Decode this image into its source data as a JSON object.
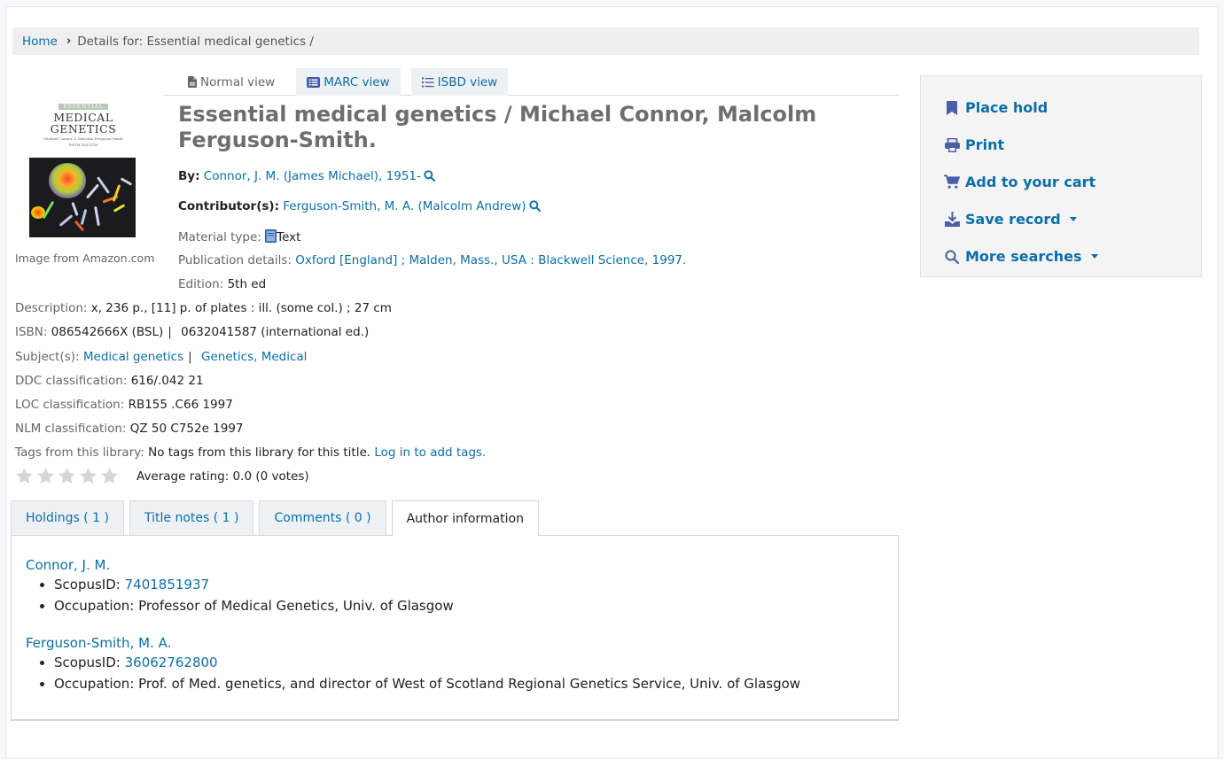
{
  "breadcrumb": {
    "home": "Home",
    "separator": "›",
    "current": "Details for: Essential medical genetics /"
  },
  "cover": {
    "credit": "Image from Amazon.com",
    "cover_text": {
      "series": "ESSENTIAL",
      "line1": "MEDICAL",
      "line2": "GENETICS",
      "authors": "Michael Connor & Malcolm Ferguson-Smith",
      "edition": "FIFTH EDITION"
    }
  },
  "view_tabs": [
    {
      "label": "Normal view",
      "icon": "file-icon",
      "active": true
    },
    {
      "label": "MARC view",
      "icon": "list-alt-icon",
      "active": false
    },
    {
      "label": "ISBD view",
      "icon": "list-icon",
      "active": false
    }
  ],
  "record": {
    "title": "Essential medical genetics / Michael Connor, Malcolm Ferguson-Smith.",
    "by_label": "By:",
    "by_value": "Connor, J. M. (James Michael), 1951-",
    "contributors_label": "Contributor(s):",
    "contributors_value": "Ferguson-Smith, M. A. (Malcolm Andrew)",
    "material_type_label": "Material type:",
    "material_type_value": "Text",
    "publication_label": "Publication details:",
    "publication_value": "Oxford [England] ; Malden, Mass., USA : Blackwell Science, 1997.",
    "edition_label": "Edition:",
    "edition_value": "5th ed",
    "description_label": "Description:",
    "description_value": "x, 236 p., [11] p. of plates : ill. (some col.) ; 27 cm",
    "isbn_label": "ISBN:",
    "isbn_values": [
      "086542666X (BSL)",
      "0632041587 (international ed.)"
    ],
    "subjects_label": "Subject(s):",
    "subjects": [
      "Medical genetics",
      "Genetics, Medical"
    ],
    "ddc_label": "DDC classification:",
    "ddc_value": "616/.042 21",
    "loc_label": "LOC classification:",
    "loc_value": "RB155 .C66 1997",
    "nlm_label": "NLM classification:",
    "nlm_value": "QZ 50 C752e 1997",
    "tags_label": "Tags from this library:",
    "tags_value": "No tags from this library for this title.",
    "tags_login": "Log in to add tags.",
    "rating_stars": 0,
    "rating_max": 5,
    "rating_text": "Average rating: 0.0 (0 votes)"
  },
  "tabs": [
    {
      "label": "Holdings ( 1 )",
      "active": false
    },
    {
      "label": "Title notes ( 1 )",
      "active": false
    },
    {
      "label": "Comments ( 0 )",
      "active": false
    },
    {
      "label": "Author information",
      "active": true
    }
  ],
  "authors": [
    {
      "name": "Connor, J. M.",
      "scopus_label": "ScopusID:",
      "scopus_id": "7401851937",
      "occupation": "Occupation: Professor of Medical Genetics, Univ. of Glasgow"
    },
    {
      "name": "Ferguson-Smith, M. A.",
      "scopus_label": "ScopusID:",
      "scopus_id": "36062762800",
      "occupation": "Occupation: Prof. of Med. genetics, and director of West of Scotland Regional Genetics Service, Univ. of Glasgow"
    }
  ],
  "actions": [
    {
      "label": "Place hold",
      "icon": "bookmark-icon",
      "dropdown": false
    },
    {
      "label": "Print",
      "icon": "print-icon",
      "dropdown": false
    },
    {
      "label": "Add to your cart",
      "icon": "cart-icon",
      "dropdown": false
    },
    {
      "label": "Save record",
      "icon": "download-icon",
      "dropdown": true
    },
    {
      "label": "More searches",
      "icon": "search-icon",
      "dropdown": true
    }
  ],
  "colors": {
    "link": "#0c6ea8",
    "icon": "#4a5fa8",
    "title": "#6e6e6e",
    "panel_bg": "#f4f4f5",
    "tab_bg": "#eef1f3"
  }
}
